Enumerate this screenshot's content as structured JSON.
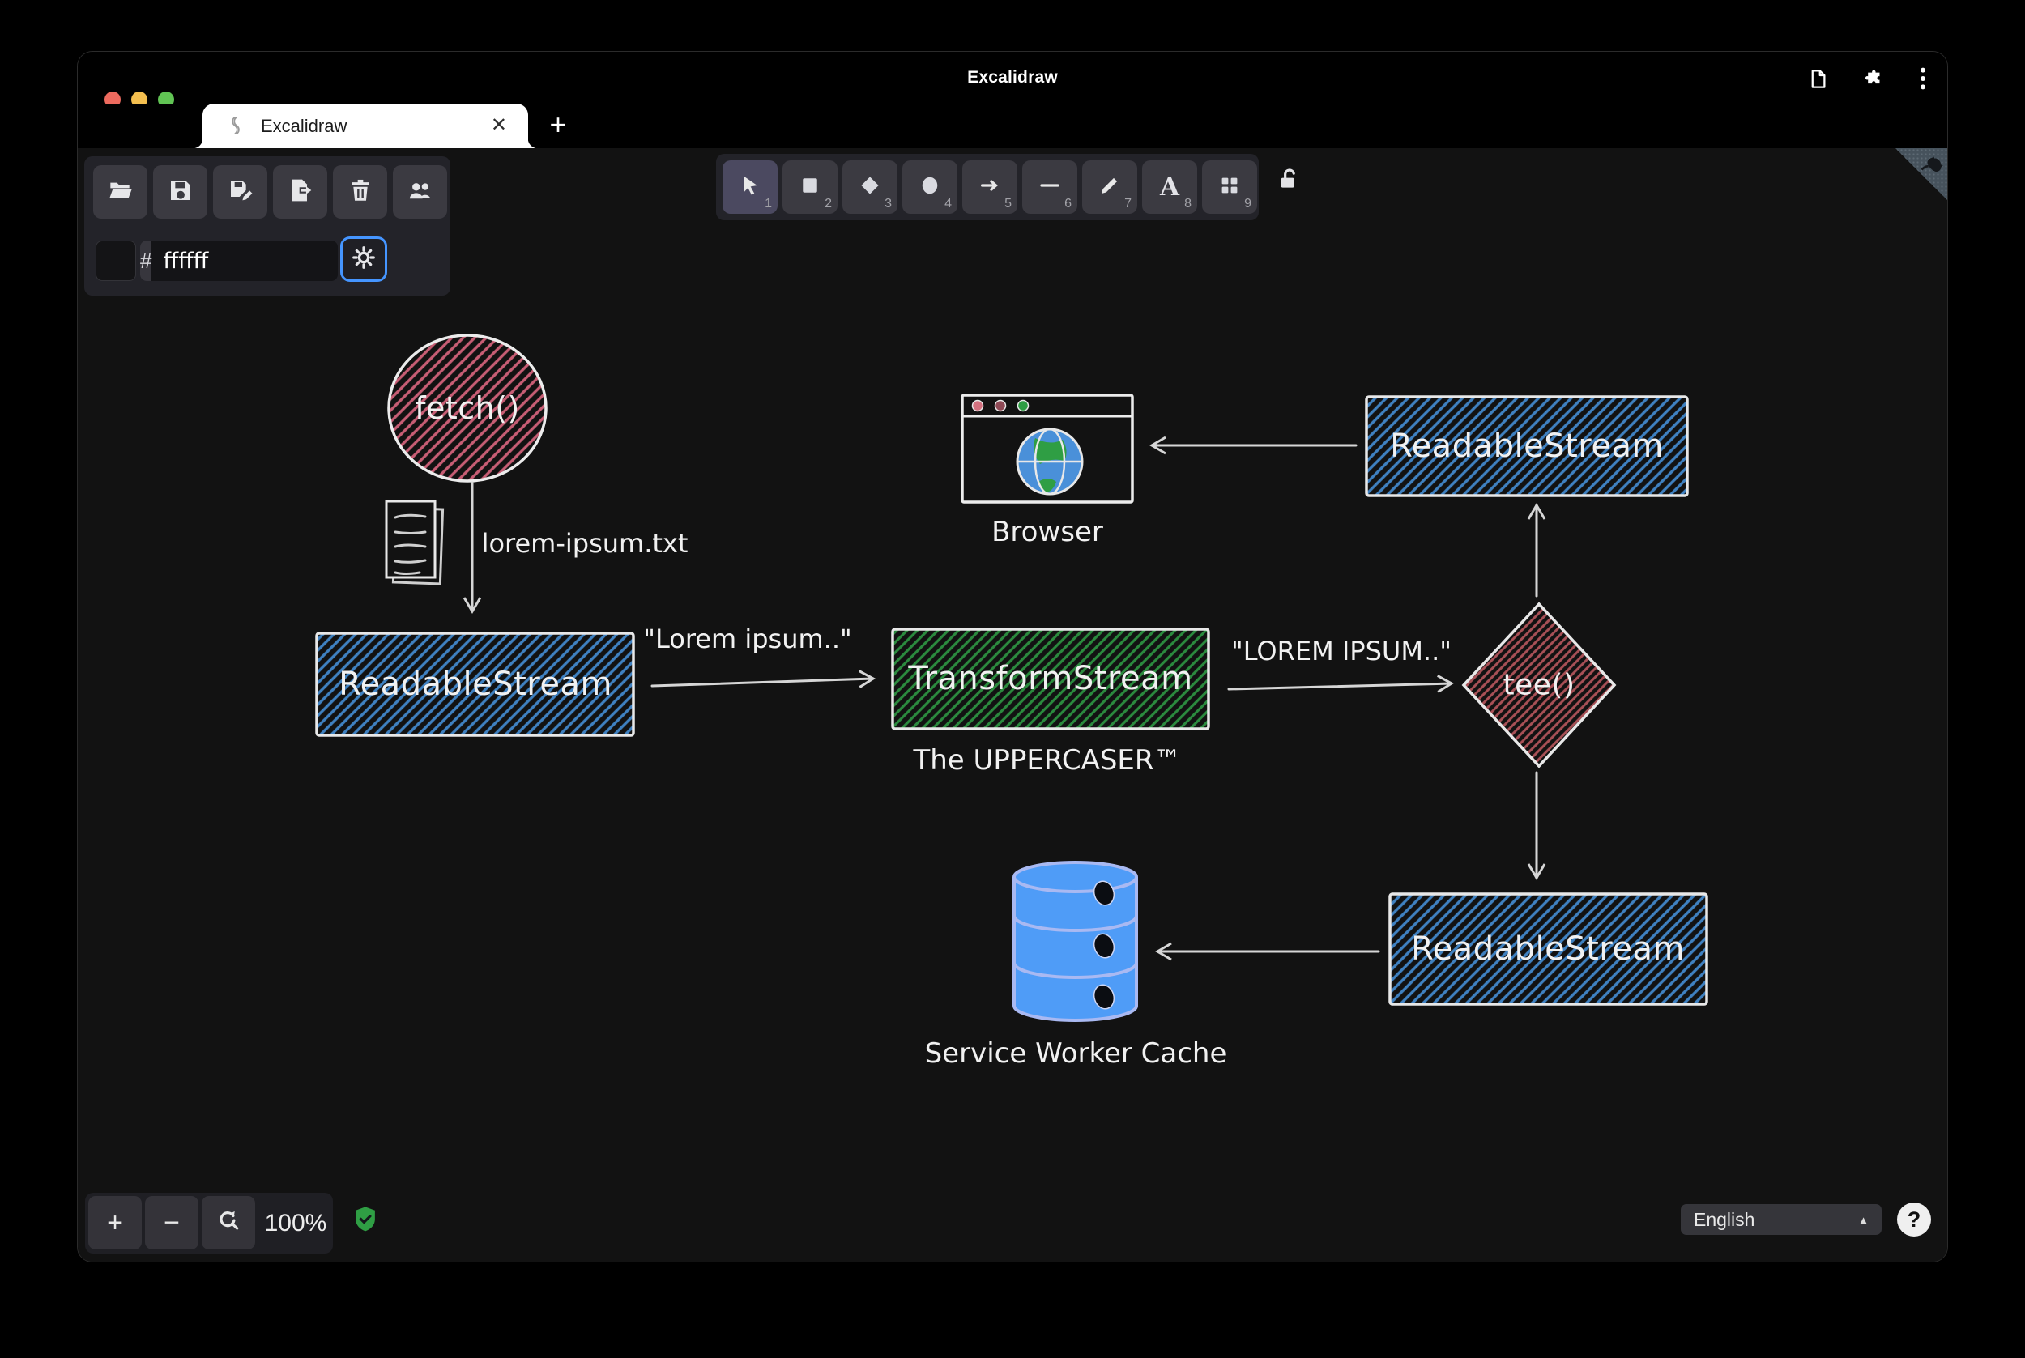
{
  "colors": {
    "accent": "#4595ff",
    "hatch_blue": "#3f81c1",
    "hatch_green": "#2b8a3e",
    "hatch_pink": "#c75d74",
    "hatch_brick": "#a85056",
    "shape_stroke": "#e8e8e8",
    "cylinder_fill": "#4f9cf7",
    "cylinder_stroke": "#a9b9f2",
    "shield_green": "#2f9e44"
  },
  "titlebar": {
    "title": "Excalidraw",
    "right_icons": [
      "page-icon",
      "extensions-puzzle-icon",
      "kebab-menu-icon"
    ]
  },
  "tab_bar": {
    "active_tab": {
      "favicon": "excalidraw-logo-icon",
      "label": "Excalidraw",
      "close": "✕"
    },
    "new_tab": "+"
  },
  "left_toolbar": {
    "buttons": [
      {
        "name": "open"
      },
      {
        "name": "save"
      },
      {
        "name": "save-as"
      },
      {
        "name": "export"
      },
      {
        "name": "clear-canvas"
      },
      {
        "name": "collaboration"
      }
    ],
    "color_picker": {
      "hash_prefix": "#",
      "value": "ffffff",
      "settings_icon": "gear-icon"
    }
  },
  "tool_bar": {
    "tools": [
      {
        "name": "selection",
        "shortcut": "1",
        "active": true
      },
      {
        "name": "rectangle",
        "shortcut": "2"
      },
      {
        "name": "diamond",
        "shortcut": "3"
      },
      {
        "name": "ellipse",
        "shortcut": "4"
      },
      {
        "name": "arrow",
        "shortcut": "5"
      },
      {
        "name": "line",
        "shortcut": "6"
      },
      {
        "name": "draw",
        "shortcut": "7"
      },
      {
        "name": "text",
        "shortcut": "8",
        "glyph": "A"
      },
      {
        "name": "library",
        "shortcut": "9"
      }
    ],
    "lock_state": "unlocked"
  },
  "diagram": {
    "nodes": {
      "fetch": "fetch()",
      "readable_left": "ReadableStream",
      "transform": "TransformStream",
      "tee": "tee()",
      "readable_top": "ReadableStream",
      "readable_bottom": "ReadableStream"
    },
    "labels": {
      "file": "lorem-ipsum.txt",
      "lorem": "\"Lorem ipsum..\"",
      "lorem_upper": "\"LOREM IPSUM..\"",
      "uppercaser": "The UPPERCASER™",
      "browser": "Browser",
      "cache": "Service Worker Cache"
    }
  },
  "footer": {
    "zoom_in": "+",
    "zoom_out": "−",
    "zoom_level": "100%",
    "encryption_icon": "shield-check-icon",
    "language": "English",
    "language_caret": "▲",
    "help": "?"
  }
}
